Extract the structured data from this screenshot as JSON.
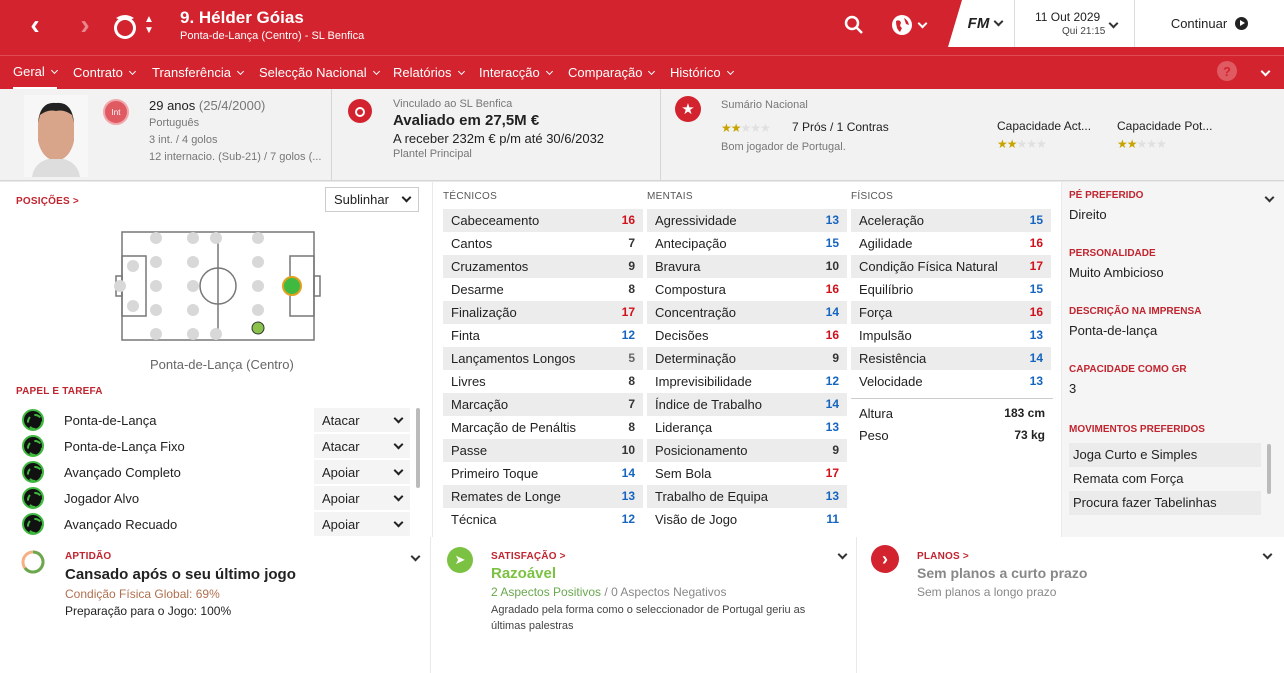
{
  "header": {
    "player_title": "9. Hélder Góias",
    "subtitle": "Ponta-de-Lança (Centro) - SL Benfica",
    "date": "11 Out 2029",
    "time": "Qui 21:15",
    "continue_label": "Continuar",
    "fm_label": "FM"
  },
  "nav": {
    "items": [
      "Geral",
      "Contrato",
      "Transferência",
      "Selecção Nacional",
      "Relatórios",
      "Interacção",
      "Comparação",
      "Histórico"
    ],
    "help": "?"
  },
  "profile": {
    "age": "29 anos",
    "dob": "(25/4/2000)",
    "nationality": "Português",
    "int_badge": "Int",
    "caps": "3 int. / 4 golos",
    "u21": "12 internacio. (Sub-21) / 7 golos (...",
    "contract_label": "Vinculado ao SL Benfica",
    "value": "Avaliado em 27,5M €",
    "wage": "A receber 232m € p/m até 30/6/2032",
    "squad": "Plantel Principal",
    "nat_summary_label": "Sumário Nacional",
    "pros_cons": "7 Prós / 1 Contras",
    "nat_desc": "Bom jogador de Portugal.",
    "ca_label": "Capacidade Act...",
    "pa_label": "Capacidade Pot...",
    "nat_stars": 2.5,
    "ca_stars": 2.5,
    "pa_stars": 2.5
  },
  "positions": {
    "title": "POSIÇÕES >",
    "select": "Sublinhar",
    "position_label": "Ponta-de-Lança (Centro)"
  },
  "roles": {
    "title": "PAPEL E TAREFA",
    "items": [
      {
        "name": "Ponta-de-Lança",
        "duty": "Atacar"
      },
      {
        "name": "Ponta-de-Lança Fixo",
        "duty": "Atacar"
      },
      {
        "name": "Avançado Completo",
        "duty": "Apoiar"
      },
      {
        "name": "Jogador Alvo",
        "duty": "Apoiar"
      },
      {
        "name": "Avançado Recuado",
        "duty": "Apoiar"
      }
    ]
  },
  "attributes": {
    "tecnicos": {
      "title": "TÉCNICOS",
      "rows": [
        [
          "Cabeceamento",
          16
        ],
        [
          "Cantos",
          7
        ],
        [
          "Cruzamentos",
          9
        ],
        [
          "Desarme",
          8
        ],
        [
          "Finalização",
          17
        ],
        [
          "Finta",
          12
        ],
        [
          "Lançamentos Longos",
          5
        ],
        [
          "Livres",
          8
        ],
        [
          "Marcação",
          7
        ],
        [
          "Marcação de Penáltis",
          8
        ],
        [
          "Passe",
          10
        ],
        [
          "Primeiro Toque",
          14
        ],
        [
          "Remates de Longe",
          13
        ],
        [
          "Técnica",
          12
        ]
      ]
    },
    "mentais": {
      "title": "MENTAIS",
      "rows": [
        [
          "Agressividade",
          13
        ],
        [
          "Antecipação",
          15
        ],
        [
          "Bravura",
          10
        ],
        [
          "Compostura",
          16
        ],
        [
          "Concentração",
          14
        ],
        [
          "Decisões",
          16
        ],
        [
          "Determinação",
          9
        ],
        [
          "Imprevisibilidade",
          12
        ],
        [
          "Índice de Trabalho",
          14
        ],
        [
          "Liderança",
          13
        ],
        [
          "Posicionamento",
          9
        ],
        [
          "Sem Bola",
          17
        ],
        [
          "Trabalho de Equipa",
          13
        ],
        [
          "Visão de Jogo",
          11
        ]
      ]
    },
    "fisicos": {
      "title": "FÍSICOS",
      "rows": [
        [
          "Aceleração",
          15
        ],
        [
          "Agilidade",
          16
        ],
        [
          "Condição Física Natural",
          17
        ],
        [
          "Equilíbrio",
          15
        ],
        [
          "Força",
          16
        ],
        [
          "Impulsão",
          13
        ],
        [
          "Resistência",
          14
        ],
        [
          "Velocidade",
          13
        ]
      ]
    },
    "height_label": "Altura",
    "height": "183 cm",
    "weight_label": "Peso",
    "weight": "73 kg"
  },
  "side": {
    "foot_label": "PÉ PREFERIDO",
    "foot": "Direito",
    "pers_label": "PERSONALIDADE",
    "pers": "Muito Ambicioso",
    "press_label": "DESCRIÇÃO NA IMPRENSA",
    "press": "Ponta-de-lança",
    "gk_label": "CAPACIDADE COMO GR",
    "gk": "3",
    "moves_label": "MOVIMENTOS PREFERIDOS",
    "moves": [
      "Joga Curto e Simples",
      "Remata com Força",
      "Procura fazer Tabelinhas"
    ]
  },
  "bottom": {
    "fit_label": "APTIDÃO",
    "fit_title": "Cansado após o seu último jogo",
    "fit_cond": "Condição Física Global: 69%",
    "fit_prep": "Preparação para o Jogo: 100%",
    "sat_label": "SATISFAÇÃO >",
    "sat_title": "Razoável",
    "sat_pos": "2 Aspectos Positivos",
    "sat_sep": " / ",
    "sat_neg": "0 Aspectos Negativos",
    "sat_desc": "Agradado pela forma como o seleccionador de Portugal geriu as últimas palestras",
    "plan_label": "PLANOS >",
    "plan_short": "Sem planos a curto prazo",
    "plan_long": "Sem planos a longo prazo"
  },
  "colors": {
    "brand": "#d2232e",
    "high": "#d0101b",
    "mid": "#1565c0",
    "low": "#666666",
    "sat": "#7cc242"
  }
}
